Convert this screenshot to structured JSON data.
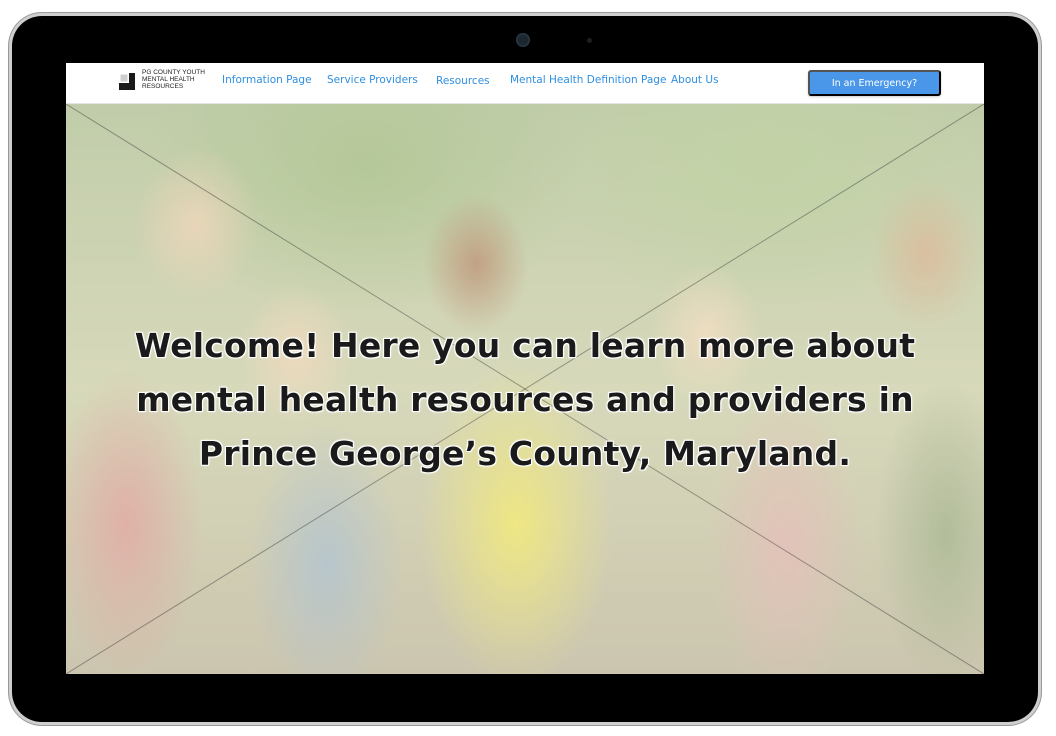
{
  "site": {
    "logo_text": "PG COUNTY YOUTH MENTAL HEALTH RESOURCES",
    "logo_icon": "cube-logo-icon"
  },
  "nav": {
    "links": [
      {
        "label": "Information Page"
      },
      {
        "label": "Service Providers"
      },
      {
        "label": "Resources"
      },
      {
        "label": "Mental Health Definition Page"
      },
      {
        "label": "About Us"
      }
    ],
    "emergency_button": "In an Emergency?"
  },
  "hero": {
    "heading": "Welcome! Here you can learn more about mental health resources and providers in Prince George’s County, Maryland.",
    "image": "group-of-smiling-young-people-giving-thumbs-up-photo"
  },
  "colors": {
    "link": "#2f8fe0",
    "button": "#4a97ea",
    "device_frame": "#000000"
  }
}
